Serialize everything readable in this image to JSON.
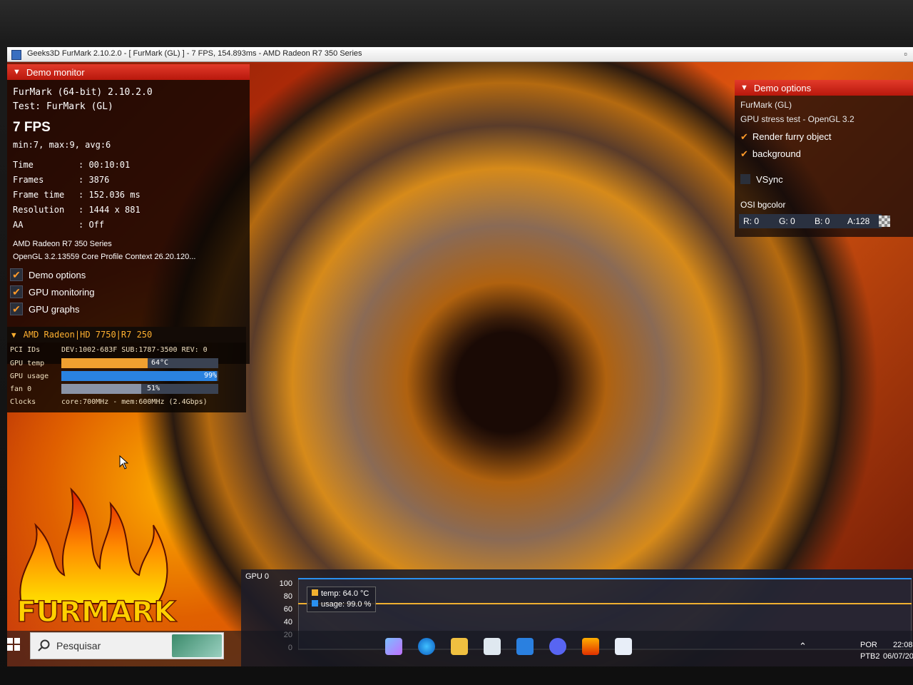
{
  "window": {
    "title": "Geeks3D FurMark 2.10.2.0 - [ FurMark (GL) ] - 7 FPS, 154.893ms - AMD Radeon R7 350 Series",
    "controls": "▫"
  },
  "demo_monitor": {
    "header": "Demo monitor",
    "app_line": "FurMark (64-bit) 2.10.2.0",
    "test_line": "Test: FurMark (GL)",
    "fps": "7 FPS",
    "fps_stats": "min:7, max:9, avg:6",
    "stats": [
      {
        "label": "Time",
        "value": ": 00:10:01"
      },
      {
        "label": "Frames",
        "value": ": 3876"
      },
      {
        "label": "Frame time",
        "value": ": 152.036 ms"
      },
      {
        "label": "Resolution",
        "value": ": 1444 x 881"
      },
      {
        "label": "AA",
        "value": ": Off"
      }
    ],
    "gpu_name": "AMD Radeon R7 350 Series",
    "gl_context": "OpenGL 3.2.13559 Core Profile Context 26.20.120...",
    "checkboxes": [
      {
        "label": "Demo options",
        "checked": true
      },
      {
        "label": "GPU monitoring",
        "checked": true
      },
      {
        "label": "GPU graphs",
        "checked": true
      }
    ]
  },
  "gpu_monitor": {
    "header": "AMD Radeon|HD 7750|R7 250",
    "pci_label": "PCI IDs",
    "pci_value": "DEV:1002-683F SUB:1787-3500 REV: 0",
    "rows": [
      {
        "label": "GPU temp",
        "value": "64°C",
        "level": 0.55,
        "color": "#f0a030"
      },
      {
        "label": "GPU usage",
        "value": "99%",
        "level": 0.99,
        "color": "#2a82e0"
      },
      {
        "label": "fan 0",
        "value": "51%",
        "level": 0.51,
        "color": "#8a93a6"
      }
    ],
    "clocks_label": "Clocks",
    "clocks_value": "core:700MHz - mem:600MHz (2.4Gbps)"
  },
  "demo_options": {
    "header": "Demo options",
    "title": "FurMark (GL)",
    "subtitle": "GPU stress test - OpenGL 3.2",
    "options": [
      {
        "label": "Render furry object",
        "checked": true
      },
      {
        "label": "background",
        "checked": true
      },
      {
        "label": "VSync",
        "checked": false
      }
    ],
    "bgcolor_label": "OSI bgcolor",
    "color": {
      "r": "R: 0",
      "g": "G: 0",
      "b": "B: 0",
      "a": "A:128"
    }
  },
  "logo_text": "FURMARK",
  "graph": {
    "title": "GPU 0",
    "y_ticks": [
      "100",
      "80",
      "60",
      "40",
      "20",
      "0"
    ],
    "legend_temp": "temp: 64.0 °C",
    "legend_usage": "usage: 99.0 %",
    "temp_value": 64.0,
    "usage_value": 99.0,
    "temp_color": "#f0b030",
    "usage_color": "#2a90f0"
  },
  "taskbar": {
    "search_placeholder": "Pesquisar",
    "lang_top": "POR",
    "lang_bottom": "PTB2",
    "time": "22:08",
    "date": "06/07/20"
  }
}
